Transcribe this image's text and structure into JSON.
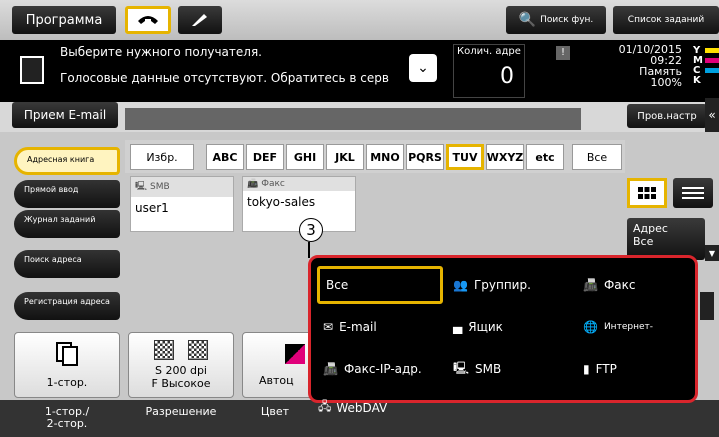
{
  "topbar": {
    "program": "Программа",
    "search_fn": "Поиск фун.",
    "jobs": "Список заданий"
  },
  "message": {
    "line1": "Выберите нужного получателя.",
    "line2": "Голосовые данные отсутствуют. Обратитесь в серв",
    "count_label": "Колич. адре",
    "count_value": "0",
    "warn": "!",
    "date": "01/10/2015",
    "time": "09:22",
    "memory_label": "Память",
    "memory_value": "100%",
    "toner": [
      "Y",
      "M",
      "C",
      "K"
    ]
  },
  "subbar": {
    "receive": "Прием E-mail",
    "check": "Пров.настр"
  },
  "sidebar": {
    "items": [
      "Адресная книга",
      "Прямой ввод",
      "Журнал заданий",
      "Поиск адреса",
      "Регистрация адреса"
    ]
  },
  "tabs": [
    "Избр.",
    "ABC",
    "DEF",
    "GHI",
    "JKL",
    "MNO",
    "PQRS",
    "TUV",
    "WXYZ",
    "etc",
    "Все"
  ],
  "tiles": [
    {
      "type": "SMB",
      "name": "user1"
    },
    {
      "type": "Факс",
      "name": "tokyo-sales"
    }
  ],
  "address_filter": {
    "label": "Адрес",
    "value": "Все"
  },
  "callout": "3",
  "popup": {
    "options": [
      "Все",
      "Группир.",
      "Факс",
      "E-mail",
      "Ящик",
      "Интернет-",
      "Факс-IP-адр.",
      "SMB",
      "FTP"
    ],
    "overflow": "WebDAV"
  },
  "functions": [
    {
      "value": "1-стор.",
      "label": "1-стор./\n2-стор."
    },
    {
      "value": "S 200 dpi\nF Высокое",
      "label": "Разрешение"
    },
    {
      "value": "Автоц",
      "label": "Цвет"
    }
  ],
  "colors": {
    "highlight": "#e6b400",
    "popup_border": "#d9252c"
  }
}
